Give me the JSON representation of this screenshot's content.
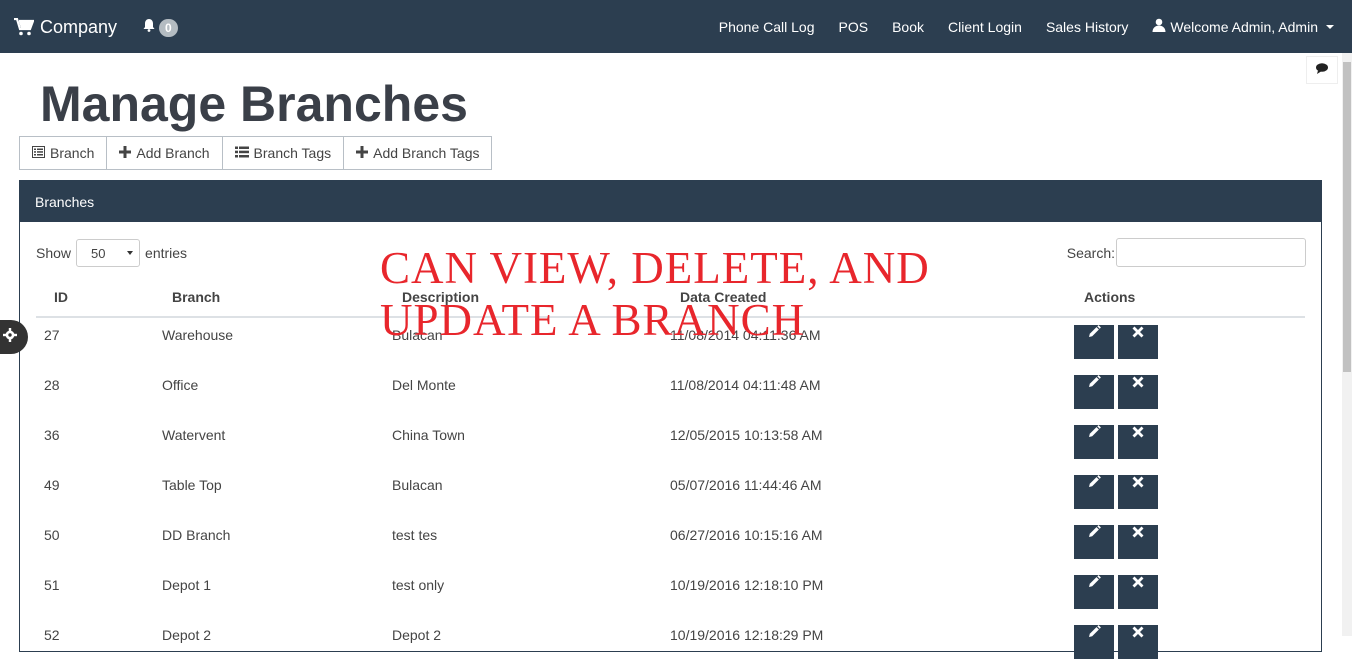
{
  "navbar": {
    "brand": "Company",
    "notif_count": "0",
    "links": [
      "Phone Call Log",
      "POS",
      "Book",
      "Client Login",
      "Sales History"
    ],
    "user_menu": "Welcome Admin, Admin"
  },
  "page": {
    "title": "Manage Branches"
  },
  "toolbar": {
    "buttons": [
      "Branch",
      "Add Branch",
      "Branch Tags",
      "Add Branch Tags"
    ]
  },
  "panel": {
    "heading": "Branches",
    "show_label": "Show",
    "entries_value": "50",
    "entries_label": "entries",
    "search_label": "Search:"
  },
  "table": {
    "columns": [
      "ID",
      "Branch",
      "Description",
      "Data Created",
      "Actions"
    ],
    "rows": [
      {
        "id": "27",
        "branch": "Warehouse",
        "description": "Bulacan",
        "created": "11/08/2014 04:11:36 AM"
      },
      {
        "id": "28",
        "branch": "Office",
        "description": "Del Monte",
        "created": "11/08/2014 04:11:48 AM"
      },
      {
        "id": "36",
        "branch": "Watervent",
        "description": "China Town",
        "created": "12/05/2015 10:13:58 AM"
      },
      {
        "id": "49",
        "branch": "Table Top",
        "description": "Bulacan",
        "created": "05/07/2016 11:44:46 AM"
      },
      {
        "id": "50",
        "branch": "DD Branch",
        "description": "test tes",
        "created": "06/27/2016 10:15:16 AM"
      },
      {
        "id": "51",
        "branch": "Depot 1",
        "description": "test only",
        "created": "10/19/2016 12:18:10 PM"
      },
      {
        "id": "52",
        "branch": "Depot 2",
        "description": "Depot 2",
        "created": "10/19/2016 12:18:29 PM"
      }
    ]
  },
  "overlay": {
    "line1": "CAN VIEW, DELETE, AND",
    "line2": "UPDATE A  BRANCH"
  },
  "colors": {
    "navbar": "#2c3e50",
    "overlay_text": "#e8262c"
  }
}
